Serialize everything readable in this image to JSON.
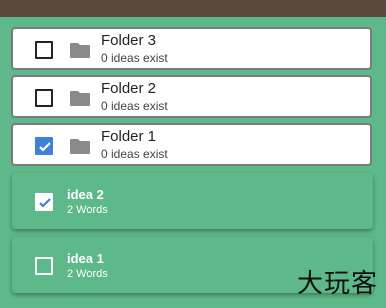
{
  "folders": [
    {
      "title": "Folder 3",
      "subtitle": "0 ideas exist",
      "checked": false
    },
    {
      "title": "Folder 2",
      "subtitle": "0 ideas exist",
      "checked": false
    },
    {
      "title": "Folder 1",
      "subtitle": "0 ideas exist",
      "checked": true
    }
  ],
  "ideas": [
    {
      "title": "idea 2",
      "subtitle": "2 Words",
      "checked": true
    },
    {
      "title": "idea 1",
      "subtitle": "2 Words",
      "checked": false
    }
  ],
  "watermark": "大玩客",
  "colors": {
    "background": "#5db88a",
    "topbar": "#5a4a3e",
    "checkbox_checked": "#3d82d8",
    "folder_icon": "#8a8a8a"
  }
}
